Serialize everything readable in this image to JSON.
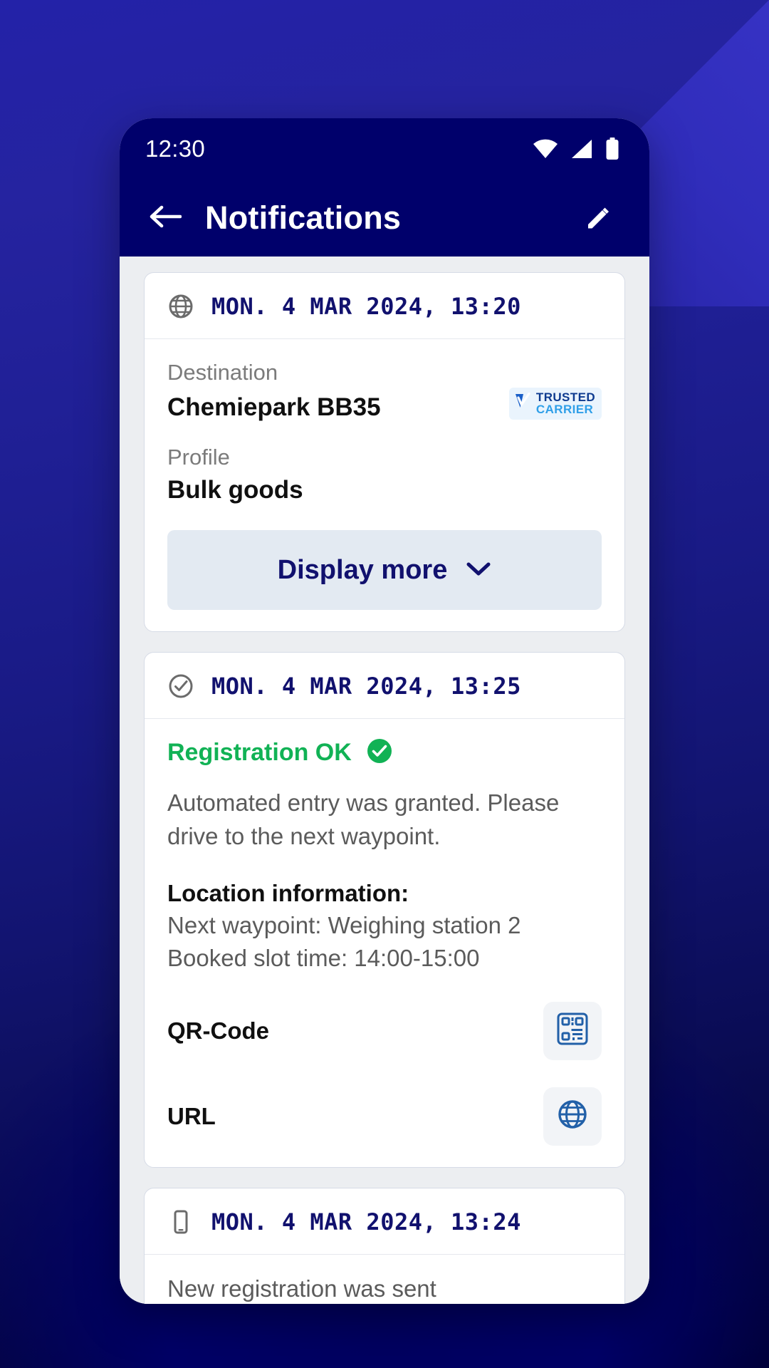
{
  "theme": {
    "brand_dark": "#00006b",
    "accent_green": "#11b255",
    "icon_blue": "#2260a8",
    "screen_bg": "#eceef1"
  },
  "statusbar": {
    "time": "12:30",
    "icons": [
      "wifi-icon",
      "cellular-signal-icon",
      "battery-icon"
    ]
  },
  "appbar": {
    "back_icon": "arrow-left-icon",
    "title": "Notifications",
    "edit_icon": "pencil-icon"
  },
  "cards": [
    {
      "icon": "globe-icon",
      "date": "MON. 4 MAR 2024, 13:20",
      "fields": [
        {
          "label": "Destination",
          "value": "Chemiepark BB35"
        },
        {
          "label": "Profile",
          "value": "Bulk goods"
        }
      ],
      "badge": {
        "line1": "TRUSTED",
        "line2": "CARRIER",
        "mark": "checkmark-v-icon"
      },
      "button": {
        "label": "Display more",
        "icon": "chevron-down-icon"
      }
    },
    {
      "icon": "check-circle-outline-icon",
      "date": "MON. 4 MAR 2024, 13:25",
      "status_text": "Registration OK",
      "status_icon": "check-circle-filled-icon",
      "paragraph": "Automated entry was granted. Please drive to the next waypoint.",
      "location_heading": "Location information:",
      "location_lines": [
        "Next waypoint: Weighing station 2",
        "Booked slot time: 14:00-15:00"
      ],
      "actions": [
        {
          "label": "QR-Code",
          "icon": "qr-code-icon"
        },
        {
          "label": "URL",
          "icon": "globe-filled-icon"
        }
      ]
    },
    {
      "icon": "mobile-phone-icon",
      "date": "MON. 4 MAR 2024, 13:24",
      "message": "New registration was sent"
    }
  ]
}
